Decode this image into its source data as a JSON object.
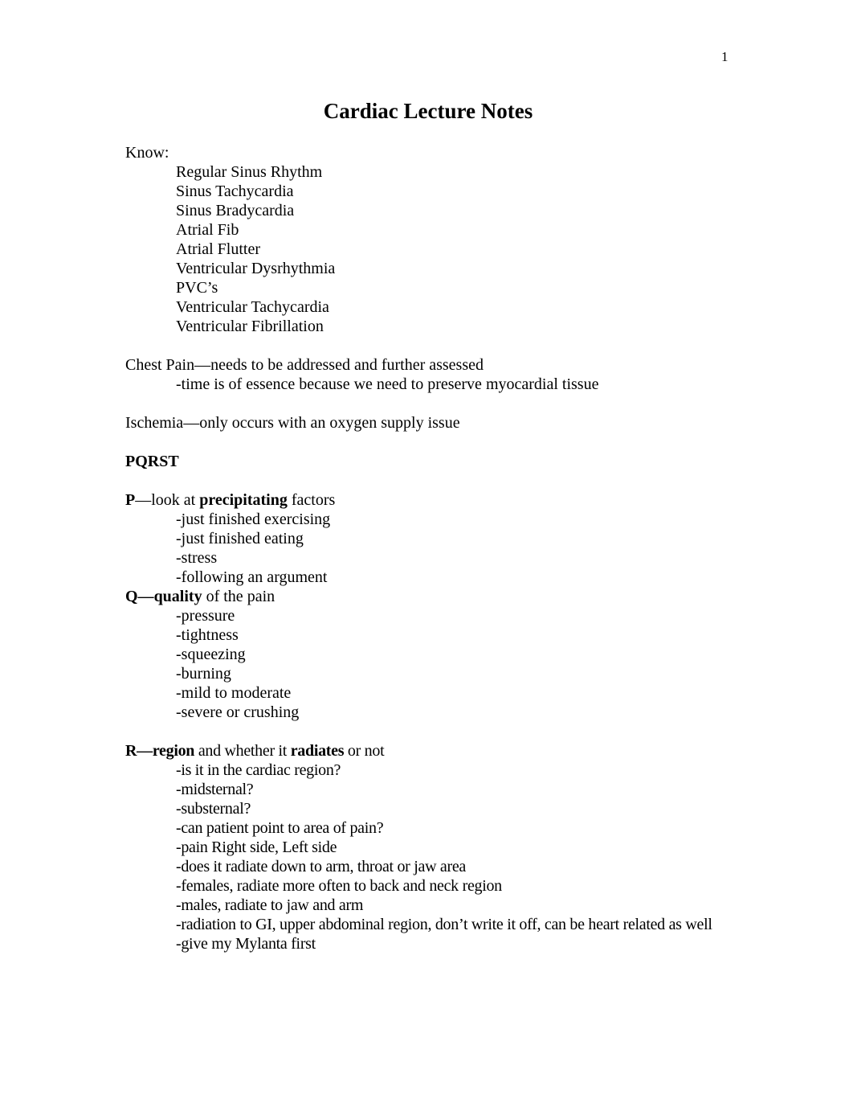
{
  "page_number": "1",
  "title": "Cardiac Lecture Notes",
  "know": {
    "heading": "Know:",
    "items": [
      "Regular Sinus Rhythm",
      "Sinus Tachycardia",
      "Sinus Bradycardia",
      "Atrial Fib",
      "Atrial Flutter",
      "Ventricular Dysrhythmia",
      "PVC’s",
      "Ventricular Tachycardia",
      "Ventricular Fibrillation"
    ]
  },
  "chest_pain": {
    "heading": "Chest Pain—needs to be addressed and further assessed",
    "note": "-time is of essence because we need to preserve myocardial tissue"
  },
  "ischemia": "Ischemia—only occurs with an oxygen supply issue",
  "pqrst_heading": "PQRST",
  "p": {
    "letter": "P",
    "dash": "—look at ",
    "keyword": "precipitating",
    "rest": " factors",
    "items": [
      "-just finished exercising",
      "-just finished eating",
      "-stress",
      "-following an argument"
    ]
  },
  "q": {
    "letter": "Q—",
    "keyword": "quality",
    "rest": " of the pain",
    "items": [
      "-pressure",
      "-tightness",
      "-squeezing",
      "-burning",
      "-mild to moderate",
      "-severe or crushing"
    ]
  },
  "r": {
    "letter": "R—",
    "keyword": "region",
    "middle": " and whether it ",
    "keyword2": "radiates",
    "rest": " or not",
    "items": [
      "-is it in the cardiac region?",
      "-midsternal?",
      "-substernal?",
      "-can patient point to area of pain?",
      "-pain Right side, Left side",
      "-does it radiate down to arm, throat or jaw area",
      "-females, radiate more often to back and neck region",
      "-males, radiate to jaw and arm",
      "-radiation to GI, upper abdominal region, don’t write it off, can be heart related as well",
      "-give my Mylanta first"
    ]
  }
}
